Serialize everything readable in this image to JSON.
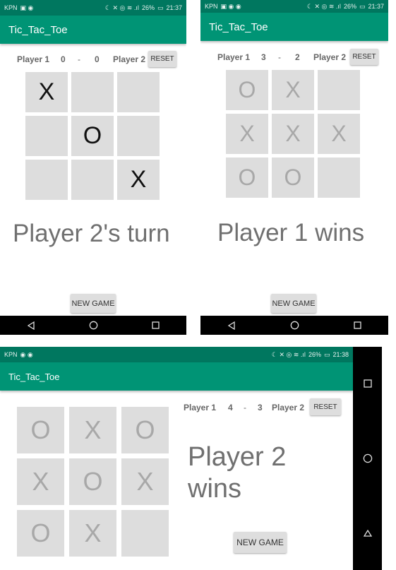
{
  "screens": [
    {
      "status": {
        "carrier": "KPN",
        "battery": "26%",
        "time": "21:37"
      },
      "app_title": "Tic_Tac_Toe",
      "score": {
        "p1_label": "Player 1",
        "p1": "0",
        "sep": "-",
        "p2": "0",
        "p2_label": "Player 2"
      },
      "reset_label": "RESET",
      "board": [
        "X",
        "",
        "",
        "",
        "O",
        "",
        "",
        "",
        "X"
      ],
      "message": "Player 2's turn",
      "new_game_label": "NEW GAME"
    },
    {
      "status": {
        "carrier": "KPN",
        "battery": "26%",
        "time": "21:37"
      },
      "app_title": "Tic_Tac_Toe",
      "score": {
        "p1_label": "Player 1",
        "p1": "3",
        "sep": "-",
        "p2": "2",
        "p2_label": "Player 2"
      },
      "reset_label": "RESET",
      "board": [
        "O",
        "X",
        "",
        "X",
        "X",
        "X",
        "O",
        "O",
        ""
      ],
      "message": "Player 1 wins",
      "new_game_label": "NEW GAME"
    },
    {
      "status": {
        "carrier": "KPN",
        "battery": "26%",
        "time": "21:38"
      },
      "app_title": "Tic_Tac_Toe",
      "score": {
        "p1_label": "Player 1",
        "p1": "4",
        "sep": "-",
        "p2": "3",
        "p2_label": "Player 2"
      },
      "reset_label": "RESET",
      "board": [
        "O",
        "X",
        "O",
        "X",
        "O",
        "X",
        "O",
        "X",
        ""
      ],
      "message": "Player 2 wins",
      "new_game_label": "NEW GAME"
    }
  ]
}
